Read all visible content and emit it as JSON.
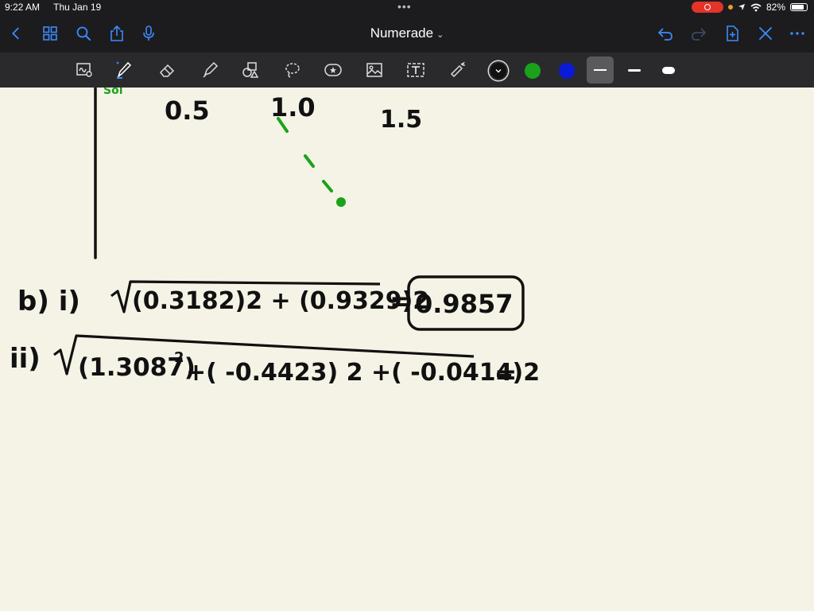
{
  "status_bar": {
    "time": "9:22 AM",
    "date": "Thu Jan 19",
    "battery": "82%",
    "battery_level": 0.82
  },
  "nav": {
    "title": "Numerade",
    "icons": [
      "back-icon",
      "grid-icon",
      "search-icon",
      "share-icon",
      "microphone-icon",
      "undo-icon",
      "redo-icon",
      "add-page-icon",
      "close-icon",
      "more-icon"
    ]
  },
  "toolbar": {
    "tools": [
      "scan-icon",
      "pen-icon",
      "eraser-icon",
      "highlighter-icon",
      "shapes-icon",
      "lasso-icon",
      "sticker-icon",
      "image-icon",
      "text-box-icon",
      "laser-pointer-icon"
    ],
    "colors": [
      "#111111",
      "#1aa21a",
      "#0b1ad6"
    ],
    "selected_color": "#111111",
    "widths": [
      "thin",
      "medium",
      "thick"
    ],
    "selected_width": "thin"
  },
  "note": {
    "axis_labels": [
      "0.5",
      "1.0",
      "1.5"
    ],
    "partial_label": "Sol",
    "part_b_i_label": "b)  i)",
    "part_b_i_expr": "(0.3182)2 + (0.9329)2",
    "equals": "=",
    "part_b_i_result": "0.9857",
    "part_b_ii_label": "ii)",
    "part_b_ii_expr_1": "(1.3087)",
    "part_b_ii_sup": "2",
    "part_b_ii_expr_2": "+( -0.4423) 2 +( -0.0414)2"
  }
}
